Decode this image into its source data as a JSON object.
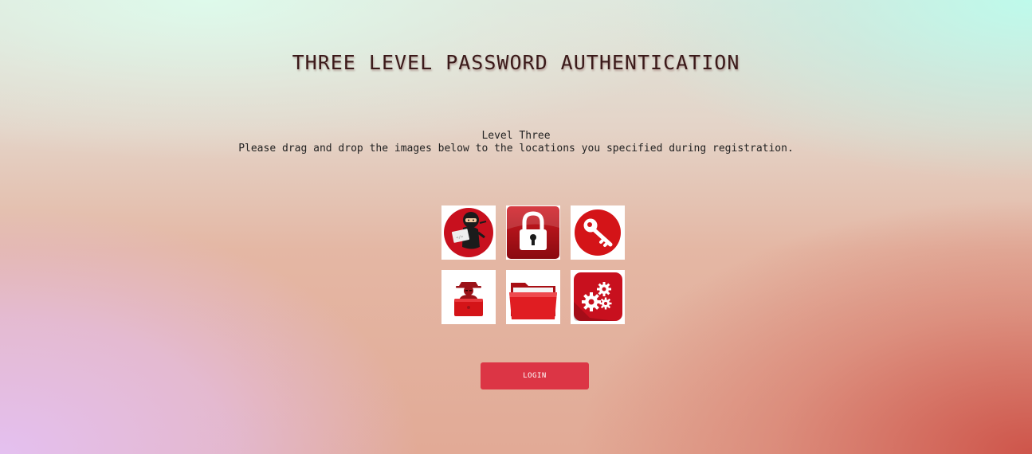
{
  "header": {
    "title": "THREE LEVEL PASSWORD AUTHENTICATION"
  },
  "instructions": {
    "level": "Level Three",
    "text": "Please drag and drop the images below to the locations you specified during registration."
  },
  "images": [
    {
      "icon": "ninja-hacker-icon"
    },
    {
      "icon": "padlock-icon"
    },
    {
      "icon": "key-icon"
    },
    {
      "icon": "spy-laptop-icon"
    },
    {
      "icon": "folder-icon"
    },
    {
      "icon": "gears-icon"
    }
  ],
  "actions": {
    "login_label": "LOGIN"
  },
  "colors": {
    "accent": "#dc3545",
    "icon_red": "#c8101e",
    "title": "#3b1a1a"
  }
}
